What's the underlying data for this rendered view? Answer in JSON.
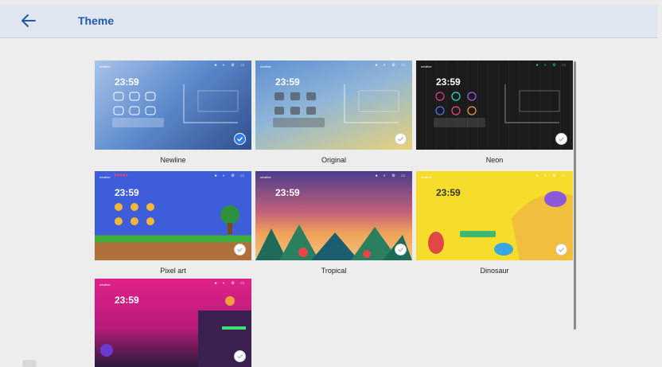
{
  "header": {
    "title": "Theme"
  },
  "thumb_time": "23:59",
  "thumb_brand": "newline",
  "themes": [
    {
      "label": "Newline",
      "selected": true
    },
    {
      "label": "Original",
      "selected": false
    },
    {
      "label": "Neon",
      "selected": false
    },
    {
      "label": "Pixel art",
      "selected": false
    },
    {
      "label": "Tropical",
      "selected": false
    },
    {
      "label": "Dinosaur",
      "selected": false
    },
    {
      "label": "",
      "selected": false
    }
  ],
  "colors": {
    "accent": "#1f5ba8",
    "selected_check": "#2f7be2"
  }
}
